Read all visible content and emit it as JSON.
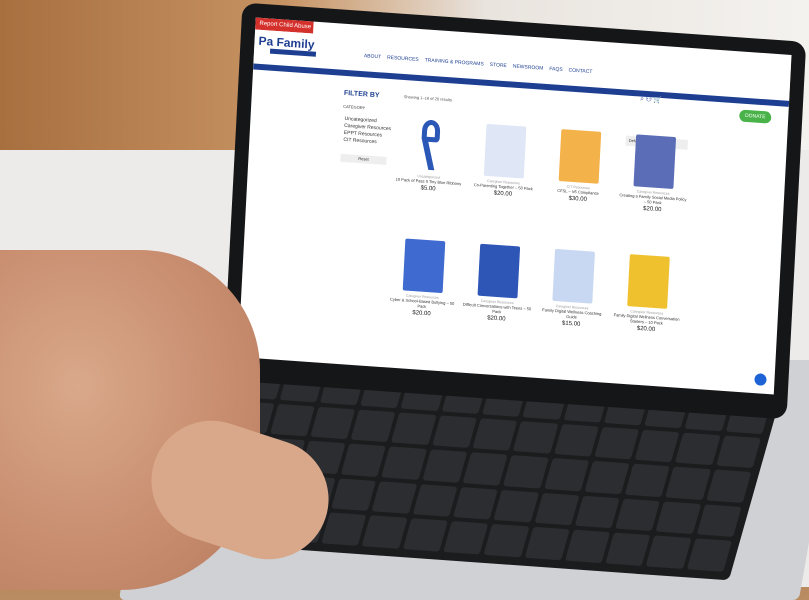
{
  "site": {
    "top_tag": "Report Child Abuse →",
    "logo": "Pa Family",
    "nav": [
      "ABOUT",
      "RESOURCES",
      "TRAINING & PROGRAMS",
      "STORE",
      "NEWSROOM",
      "FAQS",
      "CONTACT"
    ],
    "login_bar": "LOGIN | REGISTER | PAY MY BILL",
    "donate": "DONATE"
  },
  "sidebar": {
    "filter_title": "FILTER BY",
    "category_title": "CATEGORY",
    "categories": [
      "Uncategorized",
      "Caregiver Resources",
      "EPPT Resources",
      "CIT Resources"
    ],
    "reset": "Reset"
  },
  "results": {
    "showing": "Showing 1–16 of 20 results",
    "sort": "Default sorting"
  },
  "products": [
    {
      "category": "Uncategorized",
      "name": "10 Pack of Pass It Tiny Blue Ribbons",
      "price": "$5.00"
    },
    {
      "category": "Caregiver Resources",
      "name": "Co-Parenting Together – 50 Pack",
      "price": "$20.00"
    },
    {
      "category": "CIT Resources",
      "name": "CFSL – V6 Compliance",
      "price": "$30.00"
    },
    {
      "category": "Caregiver Resources",
      "name": "Creating a Family Social Media Policy – 50 Pack",
      "price": "$20.00"
    },
    {
      "category": "Caregiver Resources",
      "name": "Cyber & School-Based Bullying – 50 Pack",
      "price": "$20.00"
    },
    {
      "category": "Caregiver Resources",
      "name": "Difficult Conversations with Teens – 50 Pack",
      "price": "$20.00"
    },
    {
      "category": "Caregiver Resources",
      "name": "Family Digital Wellness Coaching Guide",
      "price": "$15.00"
    },
    {
      "category": "Caregiver Resources",
      "name": "Family Digital Wellness Conversation Starters – 10 Pack",
      "price": "$20.00"
    }
  ],
  "colors": {
    "brand_blue": "#1e3f91",
    "accent_red": "#d5312c",
    "donate_green": "#49b34a"
  }
}
